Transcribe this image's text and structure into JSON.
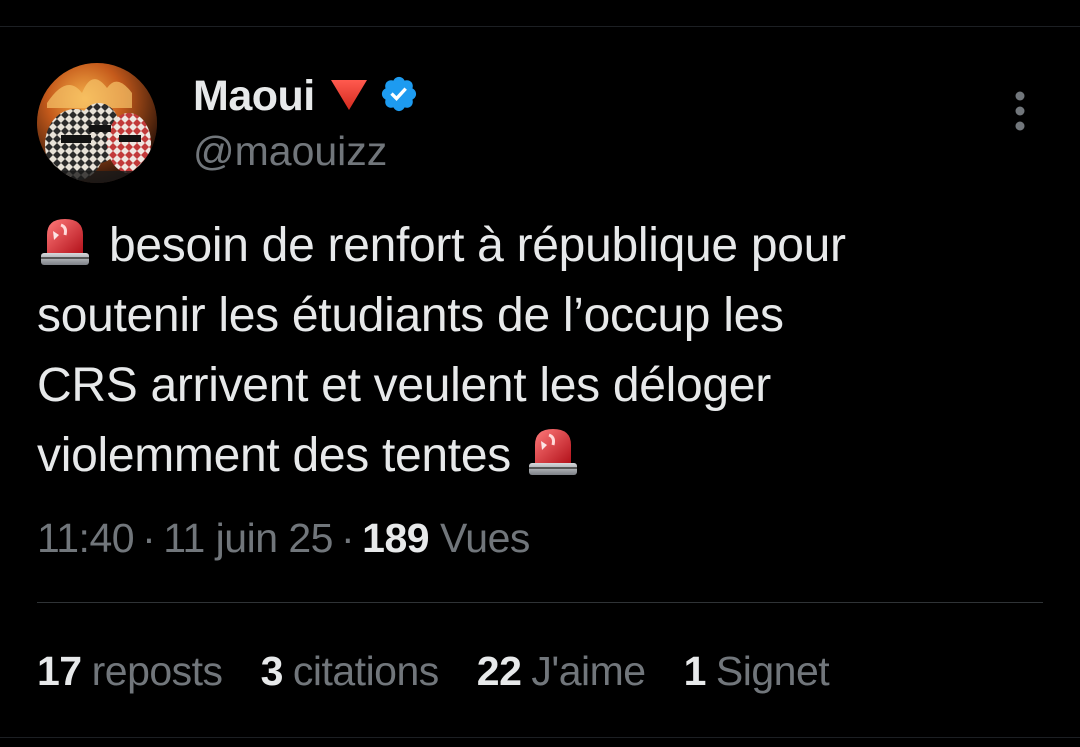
{
  "author": {
    "display_name": "Maoui",
    "handle": "@maouizz",
    "name_emoji": "red-triangle-down-icon",
    "verified": true,
    "verified_color": "#1d9bf0"
  },
  "tweet": {
    "lines": [
      "besoin de renfort à république pour",
      "soutenir les étudiants de l’occup les",
      "CRS arrivent et veulent les déloger",
      "violemment des tentes"
    ],
    "emoji": "police-siren-icon",
    "time": "11:40",
    "date": "11 juin 25",
    "views_count": "189",
    "views_label": "Vues",
    "separator": "·"
  },
  "stats": [
    {
      "count": "17",
      "label": "reposts"
    },
    {
      "count": "3",
      "label": "citations"
    },
    {
      "count": "22",
      "label": "J'aime"
    },
    {
      "count": "1",
      "label": "Signet"
    }
  ],
  "colors": {
    "background": "#000000",
    "text_primary": "#e7e9ea",
    "text_secondary": "#71767b",
    "divider": "#2f3336"
  }
}
